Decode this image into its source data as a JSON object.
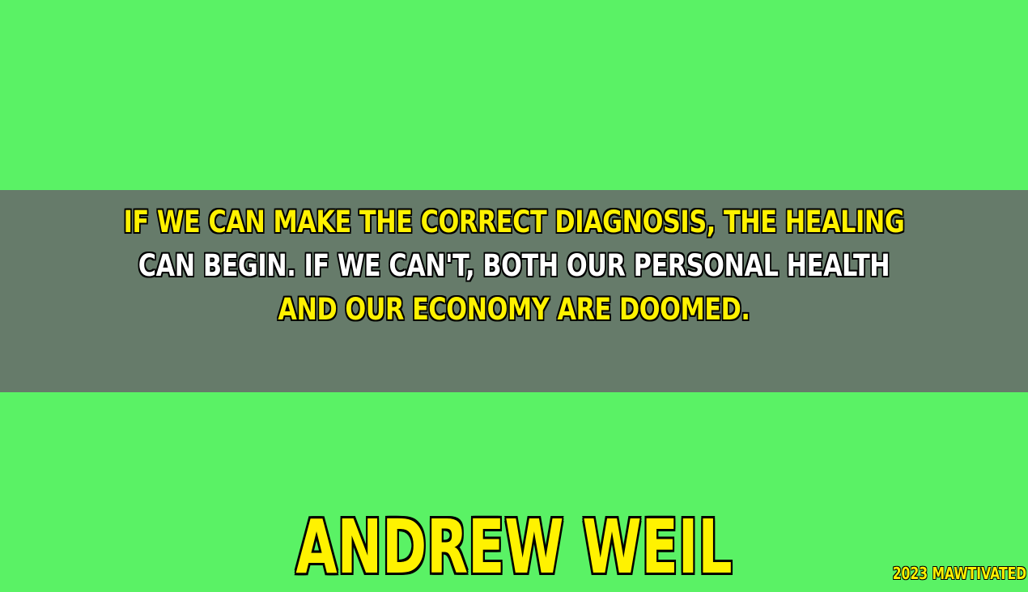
{
  "quote": {
    "lines": [
      "IF WE CAN MAKE THE CORRECT DIAGNOSIS, THE HEALING",
      "CAN BEGIN. IF WE CAN'T, BOTH OUR PERSONAL HEALTH",
      "AND OUR ECONOMY ARE DOOMED."
    ],
    "line_colors": [
      "#fff200",
      "#ffffff",
      "#fff200"
    ]
  },
  "author": "ANDREW WEIL",
  "credit": "2023 MAWTIVATED",
  "colors": {
    "background": "#5af265",
    "band": "#667b6a",
    "text_yellow": "#fff200",
    "text_white": "#ffffff",
    "outline": "#000000"
  }
}
